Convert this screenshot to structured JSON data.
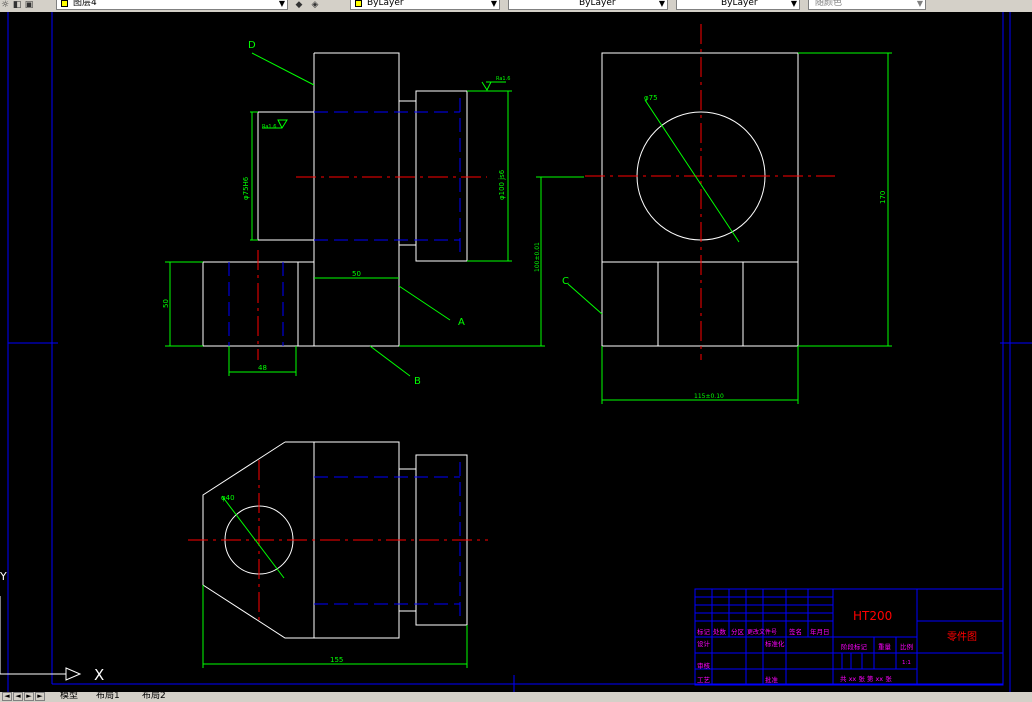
{
  "toolbar": {
    "layer_label": "图层4",
    "color_label": "ByLayer",
    "linetype_label": "ByLayer",
    "lineweight_label": "ByLayer",
    "plotstyle_label": "随颜色"
  },
  "drawing": {
    "label_d": "D",
    "label_a": "A",
    "label_b": "B",
    "label_c": "C",
    "dim_75h6": "φ75H6",
    "dim_100js6": "φ100 js6",
    "dim_50_top": "50",
    "dim_50_left": "50",
    "dim_48": "48",
    "dim_100": "100±0.01",
    "dim_170": "170",
    "dim_115": "115±0.10",
    "dim_155": "155",
    "dim_phi75": "φ75",
    "dim_phi40": "φ40",
    "rough_1": "Ra1.6",
    "rough_2": "Ra1.6"
  },
  "title_block": {
    "material": "HT200",
    "drawing_name": "零件图",
    "row_labels": [
      "标记",
      "处数",
      "分区",
      "更改文件号",
      "签名",
      "年月日"
    ],
    "design": "设计",
    "standardize": "标准化",
    "review": "审核",
    "process": "工艺",
    "approve": "批准",
    "stage_mark": "阶段标记",
    "weight": "重量",
    "scale": "比例",
    "scale_value": "1:1",
    "sheets": "共 xx 张 第 xx 张"
  },
  "ucs": {
    "x_label": "X",
    "y_label": "Y"
  },
  "tabs": {
    "nav": [
      "◄",
      "◄",
      "►",
      "►"
    ],
    "items": [
      "模型",
      "布局1",
      "布局2"
    ]
  },
  "colors": {
    "background": "#000000",
    "outline": "#ffffff",
    "dimension": "#00ff00",
    "hidden": "#0000ff",
    "center": "#ff0000",
    "frame": "#0000ff",
    "titleblock_text": "#ff00ff",
    "material_text": "#ff0000"
  }
}
